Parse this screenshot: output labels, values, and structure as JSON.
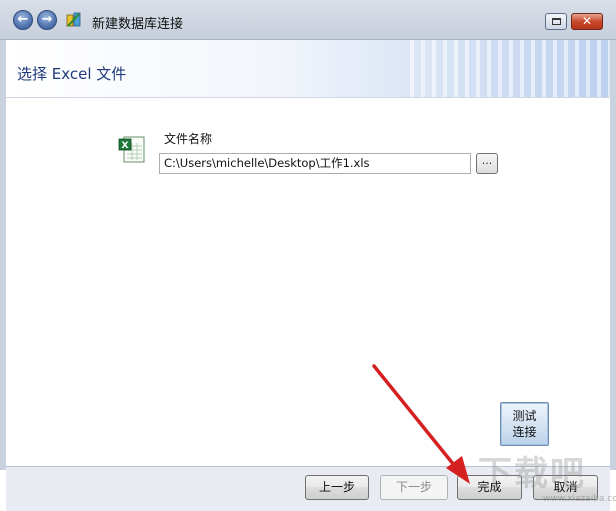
{
  "window": {
    "title": "新建数据库连接"
  },
  "header": {
    "title": "选择 Excel 文件"
  },
  "form": {
    "file_label": "文件名称",
    "file_path": "C:\\Users\\michelle\\Desktop\\工作1.xls",
    "browse_label": "..."
  },
  "test_button": {
    "line1": "测试",
    "line2": "连接"
  },
  "footer": {
    "prev_label": "上一步",
    "next_label": "下一步",
    "finish_label": "完成",
    "cancel_label": "取消"
  },
  "watermark": {
    "main": "下载吧",
    "sub": "www.xiazaiba.com"
  },
  "icons": {
    "nav_back": "arrow-left-icon",
    "nav_forward": "arrow-right-icon",
    "app": "database-app-icon",
    "excel": "excel-file-icon"
  },
  "colors": {
    "header_title": "#1e3a7d",
    "annotation_arrow": "#d42020",
    "close_button": "#c9492b"
  }
}
